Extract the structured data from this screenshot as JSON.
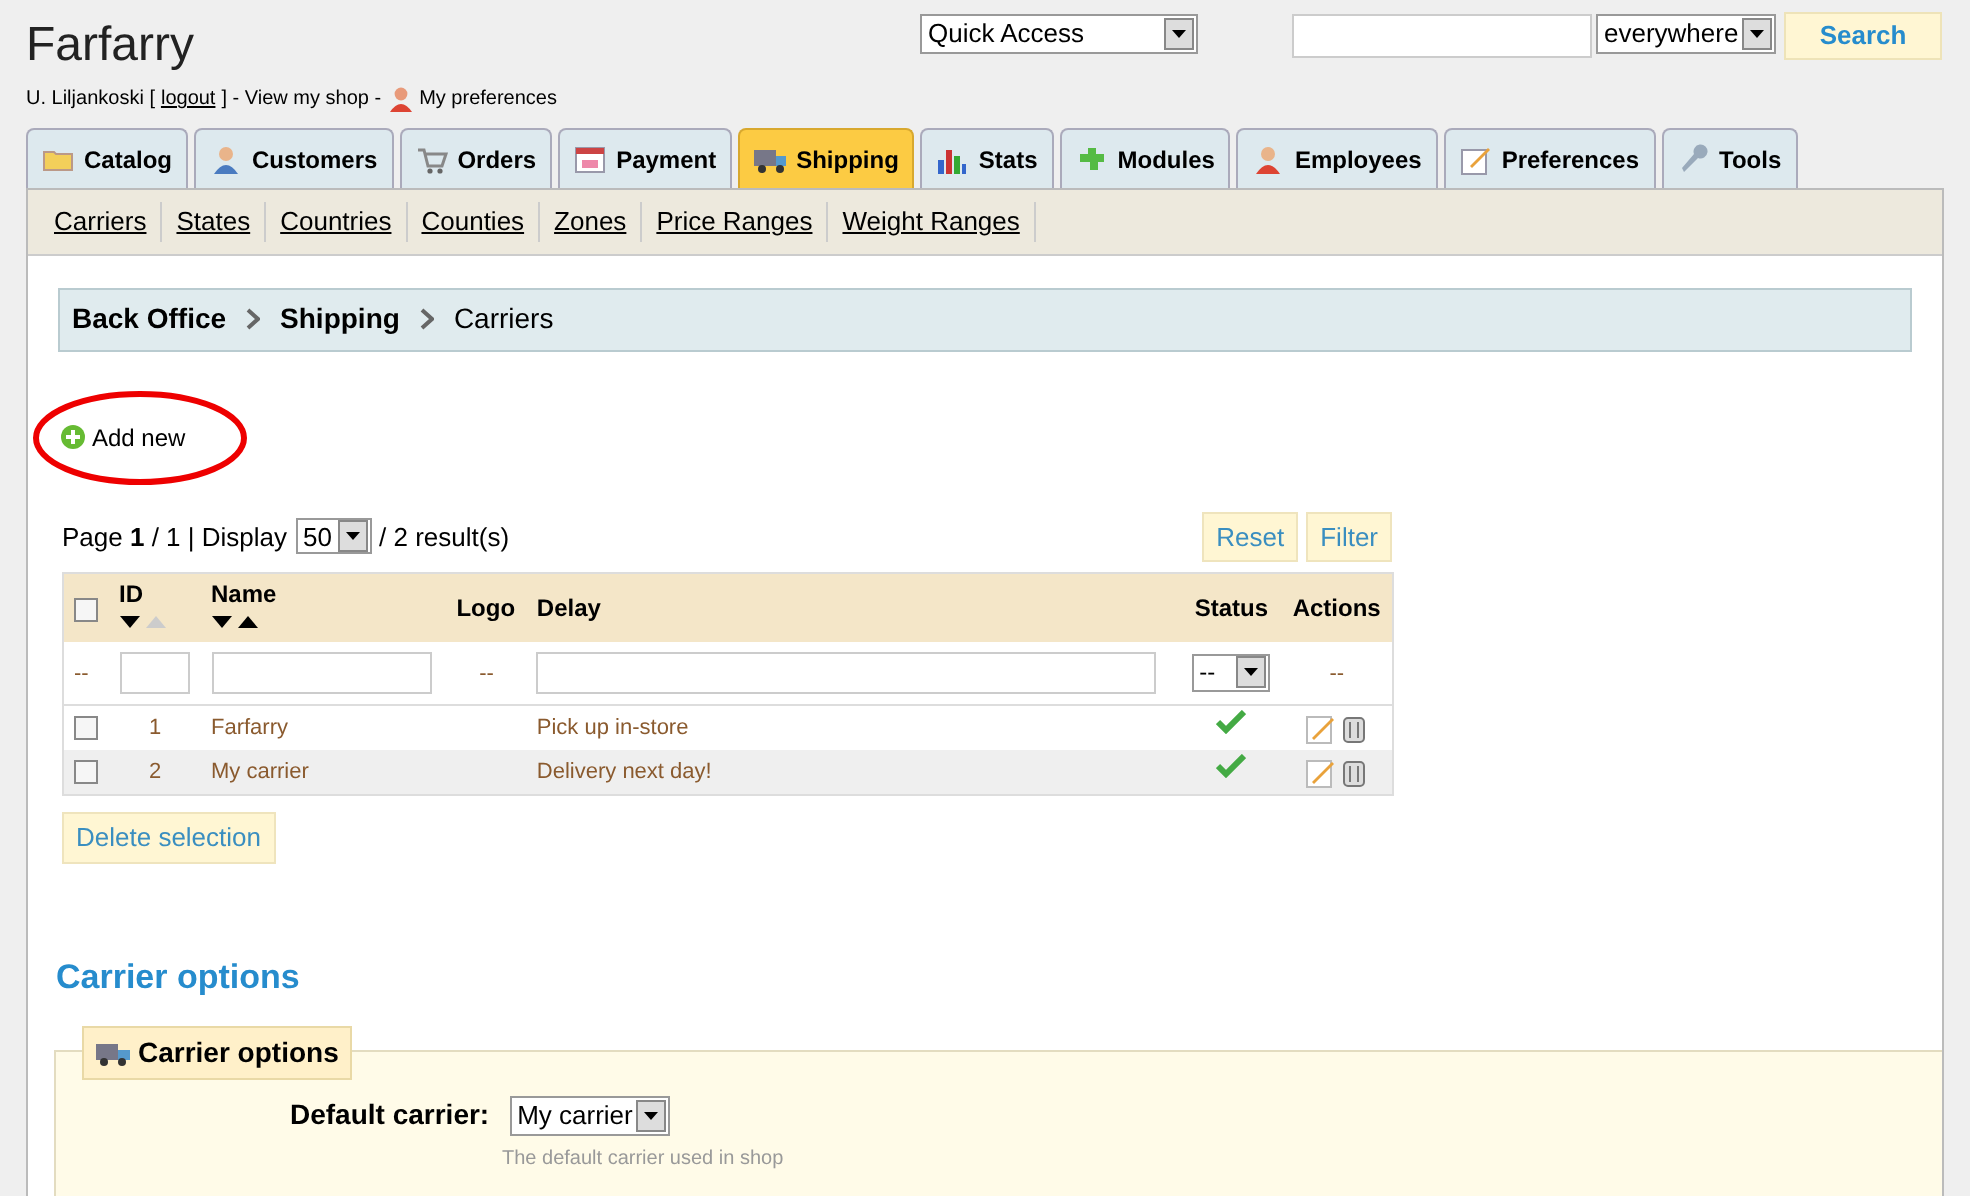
{
  "header": {
    "title": "Farfarry",
    "user": "U. Liljankoski [",
    "logout": "logout",
    "user_mid": "] - View my shop -",
    "preferences": "My preferences"
  },
  "quick_access": {
    "value": "Quick Access"
  },
  "search": {
    "scope": "everywhere",
    "button": "Search"
  },
  "tabs": [
    {
      "label": "Catalog",
      "selected": false
    },
    {
      "label": "Customers",
      "selected": false
    },
    {
      "label": "Orders",
      "selected": false
    },
    {
      "label": "Payment",
      "selected": false
    },
    {
      "label": "Shipping",
      "selected": true
    },
    {
      "label": "Stats",
      "selected": false
    },
    {
      "label": "Modules",
      "selected": false
    },
    {
      "label": "Employees",
      "selected": false
    },
    {
      "label": "Preferences",
      "selected": false
    },
    {
      "label": "Tools",
      "selected": false
    }
  ],
  "subtabs": [
    "Carriers",
    "States",
    "Countries",
    "Counties",
    "Zones",
    "Price Ranges",
    "Weight Ranges"
  ],
  "breadcrumb": [
    "Back Office",
    "Shipping",
    "Carriers"
  ],
  "add_new": {
    "label": "Add new",
    "highlighted": true
  },
  "pagination": {
    "text": "Page **1** / 1 | Display",
    "per_page": "50",
    "results": "/ 2 result(s)"
  },
  "filter_buttons": [
    "Reset",
    "Filter"
  ],
  "table": {
    "select_all_checked": false,
    "columns": [
      {
        "label": "ID",
        "sort": {
          "down": true,
          "up": false
        }
      },
      {
        "label": "Name",
        "sort": {
          "down": true,
          "up": true
        }
      },
      {
        "label": "Logo"
      },
      {
        "label": "Delay"
      },
      {
        "label": "Status"
      },
      {
        "label": "Actions"
      }
    ],
    "filters": {
      "check_dash": "--",
      "logo_dash": "--",
      "status": "--",
      "actions_dash": "--"
    },
    "rows": [
      {
        "checked": false,
        "id": "1",
        "name": "Farfarry",
        "delay": "Pick up in-store",
        "active": true
      },
      {
        "checked": false,
        "id": "2",
        "name": "My carrier",
        "delay": "Delivery next day!",
        "active": true
      }
    ]
  },
  "delete_button": "Delete selection",
  "options": {
    "heading": "Carrier options",
    "legend": "Carrier options",
    "label": "Default carrier:",
    "value": "My carrier",
    "hint": "The default carrier used in shop"
  }
}
